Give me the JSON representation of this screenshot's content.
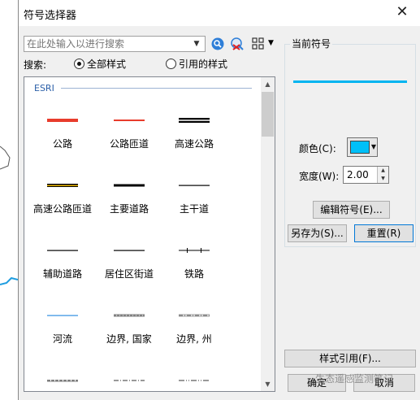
{
  "window": {
    "title": "符号选择器",
    "close_glyph": "✕"
  },
  "search": {
    "placeholder": "在此处输入以进行搜索"
  },
  "scope": {
    "label": "搜索:",
    "options": [
      {
        "label": "全部样式",
        "selected": true
      },
      {
        "label": "引用的样式",
        "selected": false
      }
    ]
  },
  "gallery": {
    "group_title": "ESRI",
    "symbols": [
      {
        "label": "公路",
        "style": "red-thick"
      },
      {
        "label": "公路匝道",
        "style": "red-thin"
      },
      {
        "label": "高速公路",
        "style": "double"
      },
      {
        "label": "高速公路匝道",
        "style": "yellow-black"
      },
      {
        "label": "主要道路",
        "style": "black-thick"
      },
      {
        "label": "主干道",
        "style": "black-thin"
      },
      {
        "label": "辅助道路",
        "style": "black-thin"
      },
      {
        "label": "居住区街道",
        "style": "black-thin"
      },
      {
        "label": "铁路",
        "style": "railroad"
      },
      {
        "label": "河流",
        "style": "blue-thin"
      },
      {
        "label": "边界, 国家",
        "style": "gray-dash"
      },
      {
        "label": "边界, 州",
        "style": "gray-dash"
      },
      {
        "label": "",
        "style": "dash-dot"
      },
      {
        "label": "",
        "style": "dash-dot2"
      },
      {
        "label": "",
        "style": "dash-dot3"
      }
    ]
  },
  "current_symbol": {
    "group_title": "当前符号",
    "color_label": "颜色(C):",
    "color_value": "#00c0f8",
    "width_label": "宽度(W):",
    "width_value": "2.00",
    "edit_button": "编辑符号(E)...",
    "save_as_button": "另存为(S)...",
    "reset_button": "重置(R)"
  },
  "footer": {
    "style_ref_button": "样式引用(F)...",
    "ok_button": "确定",
    "cancel_button": "取消"
  },
  "watermark": "生态遥感监测笔记"
}
